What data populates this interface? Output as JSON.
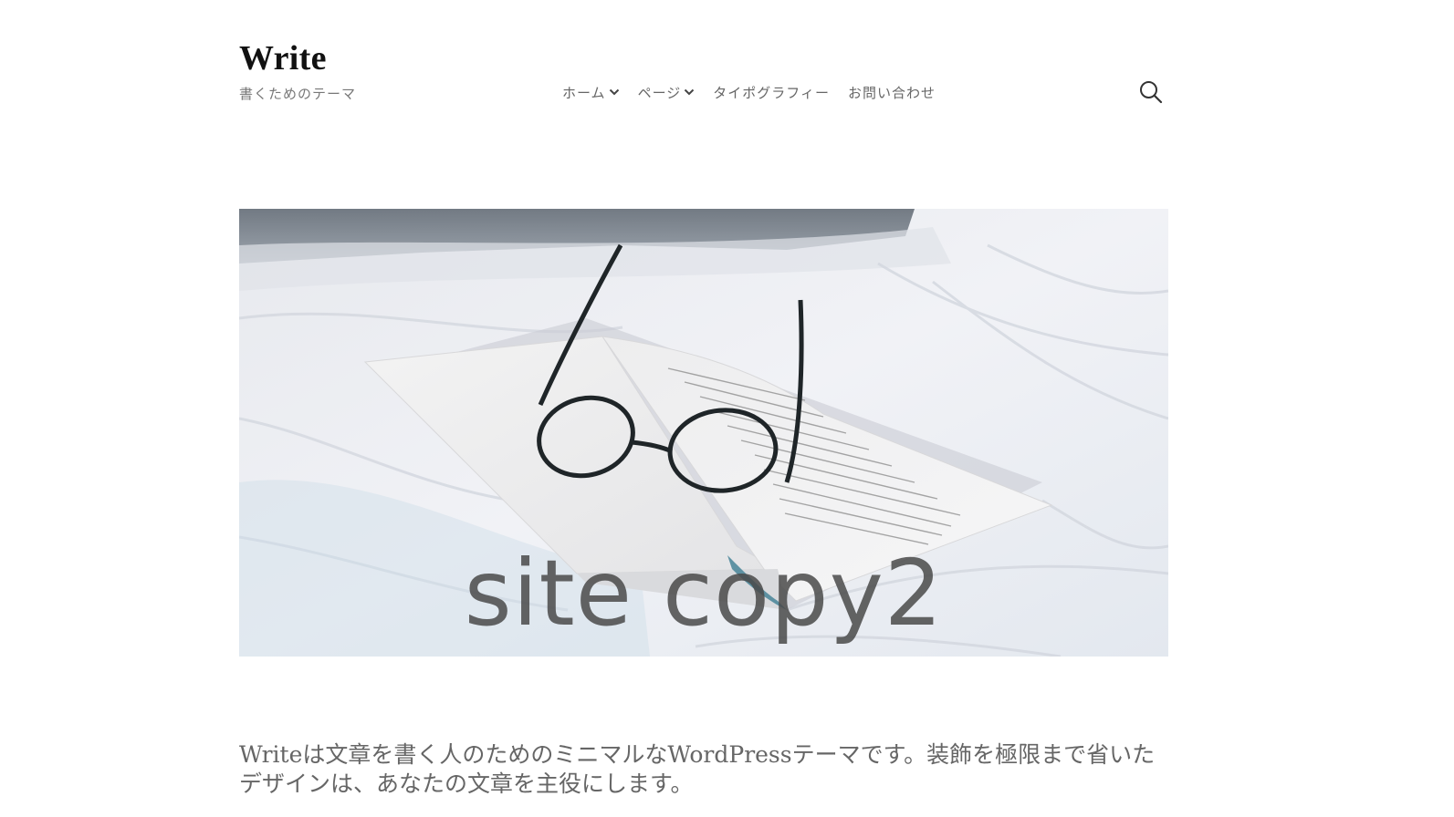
{
  "header": {
    "site_title": "Write",
    "site_description": "書くためのテーマ"
  },
  "nav": {
    "items": [
      {
        "label": "ホーム",
        "has_dropdown": true
      },
      {
        "label": "ページ",
        "has_dropdown": true
      },
      {
        "label": "タイポグラフィー",
        "has_dropdown": false
      },
      {
        "label": "お問い合わせ",
        "has_dropdown": false
      }
    ],
    "search_icon": "search-icon",
    "dropdown_icon": "chevron-down-icon"
  },
  "hero": {
    "caption": "site copy2"
  },
  "intro": {
    "text": "Writeは文章を書く人のためのミニマルなWordPressテーマです。装飾を極限まで省いたデザインは、あなたの文章を主役にします。"
  },
  "colors": {
    "title": "#111111",
    "text": "#666666",
    "background": "#ffffff"
  }
}
